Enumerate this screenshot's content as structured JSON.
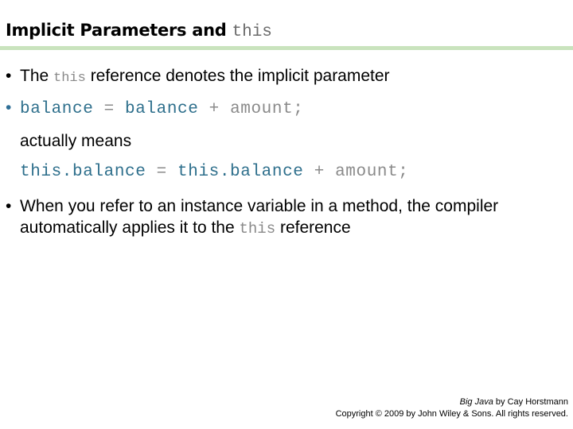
{
  "title": {
    "text": "Implicit Parameters and",
    "code": "this"
  },
  "bullets": {
    "b1": {
      "before": "The",
      "code": "this",
      "after": "reference denotes the implicit parameter"
    },
    "b2": {
      "var1": "balance",
      "eq": "=",
      "var2": "balance",
      "plus": "+",
      "amount": "amount;"
    },
    "actually": "actually means",
    "b2_expanded": {
      "var1": "this.balance",
      "eq": "=",
      "var2": "this.balance",
      "plus": "+",
      "amount": "amount;"
    },
    "b3": {
      "line1": "When you refer to an instance variable in a method, the compiler",
      "line2_before": "automatically applies it to the",
      "code": "this",
      "line2_after": "reference"
    }
  },
  "footer": {
    "book": "Big Java",
    "author": "by Cay Horstmann",
    "copyright": "Copyright © 2009 by John Wiley & Sons.  All rights reserved."
  },
  "colors": {
    "rule": "#c9e3bd",
    "code_identifier": "#2e6f8c",
    "code_gray": "#8a8a8a"
  }
}
